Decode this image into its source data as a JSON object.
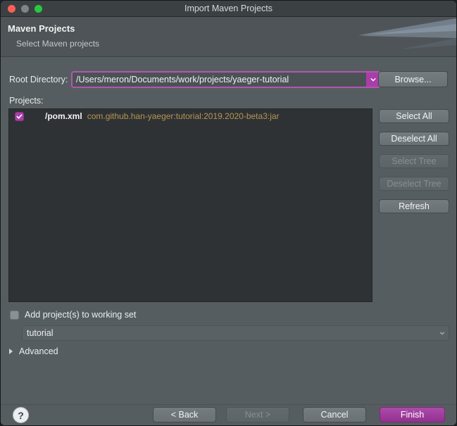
{
  "window": {
    "title": "Import Maven Projects",
    "traffic_lights": [
      "close-light",
      "minimize-light",
      "maximize-light"
    ]
  },
  "header": {
    "title": "Maven Projects",
    "subtitle": "Select Maven projects"
  },
  "form": {
    "root_directory_label": "Root Directory:",
    "root_directory_value": "/Users/meron/Documents/work/projects/yaeger-tutorial",
    "browse_label": "Browse...",
    "projects_label": "Projects:"
  },
  "projects": [
    {
      "checked": true,
      "path": "/pom.xml",
      "coordinates": "com.github.han-yaeger:tutorial:2019.2020-beta3:jar"
    }
  ],
  "side_buttons": [
    {
      "label": "Select All",
      "enabled": true
    },
    {
      "label": "Deselect All",
      "enabled": true
    },
    {
      "label": "Select Tree",
      "enabled": false
    },
    {
      "label": "Deselect Tree",
      "enabled": false
    },
    {
      "label": "Refresh",
      "enabled": true
    }
  ],
  "working_set": {
    "checkbox_label": "Add project(s) to working set",
    "checked": false,
    "value": "tutorial"
  },
  "advanced": {
    "label": "Advanced",
    "expanded": false
  },
  "footer": {
    "help_glyph": "?",
    "back_label": "< Back",
    "next_label": "Next >",
    "cancel_label": "Cancel",
    "finish_label": "Finish"
  },
  "colors": {
    "accent": "#a93ea9",
    "coordinate_text": "#b49554",
    "window_background": "#565d61",
    "list_background": "#2f3234"
  }
}
